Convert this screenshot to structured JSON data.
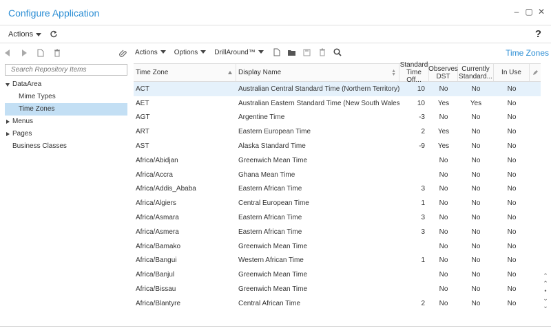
{
  "window": {
    "title": "Configure Application",
    "controls": [
      "–",
      "▢",
      "✕"
    ]
  },
  "top_actions": {
    "label": "Actions"
  },
  "help_label": "?",
  "left": {
    "search_placeholder": "Search Repository Items",
    "tree": [
      {
        "label": "DataArea",
        "level": 0,
        "expander": "down"
      },
      {
        "label": "Mime Types",
        "level": 1
      },
      {
        "label": "Time Zones",
        "level": 1,
        "selected": true
      },
      {
        "label": "Menus",
        "level": 0,
        "expander": "right"
      },
      {
        "label": "Pages",
        "level": 0,
        "expander": "right"
      },
      {
        "label": "Business Classes",
        "level": 0
      }
    ]
  },
  "toolbar": {
    "actions": "Actions",
    "options": "Options",
    "drillaround": "DrillAround™"
  },
  "panel_title": "Time Zones",
  "table": {
    "columns": {
      "tz": "Time Zone",
      "display": "Display Name",
      "offset": "Standard Time Off...",
      "dst": "Observes DST",
      "current": "Currently Standard...",
      "inuse": "In Use"
    },
    "rows": [
      [
        "ACT",
        "Australian Central Standard Time (Northern Territory)",
        "10",
        "No",
        "No",
        "No"
      ],
      [
        "AET",
        "Australian Eastern Standard Time (New South Wales)",
        "10",
        "Yes",
        "Yes",
        "No"
      ],
      [
        "AGT",
        "Argentine Time",
        "-3",
        "No",
        "No",
        "No"
      ],
      [
        "ART",
        "Eastern European Time",
        "2",
        "Yes",
        "No",
        "No"
      ],
      [
        "AST",
        "Alaska Standard Time",
        "-9",
        "Yes",
        "No",
        "No"
      ],
      [
        "Africa/Abidjan",
        "Greenwich Mean Time",
        "",
        "No",
        "No",
        "No"
      ],
      [
        "Africa/Accra",
        "Ghana Mean Time",
        "",
        "No",
        "No",
        "No"
      ],
      [
        "Africa/Addis_Ababa",
        "Eastern African Time",
        "3",
        "No",
        "No",
        "No"
      ],
      [
        "Africa/Algiers",
        "Central European Time",
        "1",
        "No",
        "No",
        "No"
      ],
      [
        "Africa/Asmara",
        "Eastern African Time",
        "3",
        "No",
        "No",
        "No"
      ],
      [
        "Africa/Asmera",
        "Eastern African Time",
        "3",
        "No",
        "No",
        "No"
      ],
      [
        "Africa/Bamako",
        "Greenwich Mean Time",
        "",
        "No",
        "No",
        "No"
      ],
      [
        "Africa/Bangui",
        "Western African Time",
        "1",
        "No",
        "No",
        "No"
      ],
      [
        "Africa/Banjul",
        "Greenwich Mean Time",
        "",
        "No",
        "No",
        "No"
      ],
      [
        "Africa/Bissau",
        "Greenwich Mean Time",
        "",
        "No",
        "No",
        "No"
      ],
      [
        "Africa/Blantyre",
        "Central African Time",
        "2",
        "No",
        "No",
        "No"
      ]
    ],
    "selected_row": 0
  },
  "colors": {
    "accent": "#2a8dd4",
    "selection": "#c3dff4"
  }
}
